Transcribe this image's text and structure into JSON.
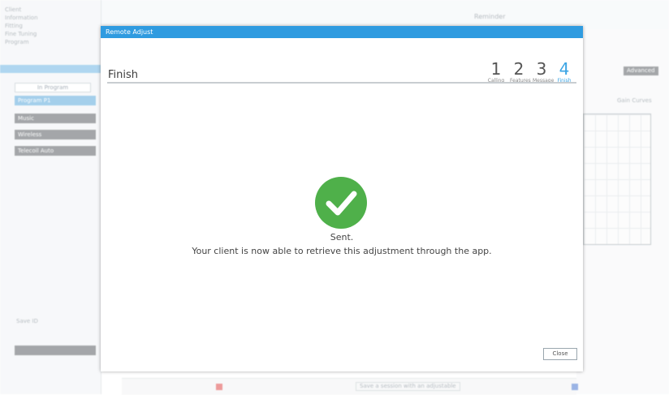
{
  "background": {
    "left_items": [
      "Client",
      "Information",
      "Fitting",
      "Fine Tuning",
      "Program"
    ],
    "in_program_label": "In Program",
    "program_buttons": [
      "Program P1",
      "Music",
      "Wireless",
      "Telecoil Auto"
    ],
    "record_label": "Save ID",
    "right_tab_label": "Advanced",
    "right_graph_label": "Gain Curves",
    "top_center_label": "Reminder",
    "bottom_status": "Save a session with an adjustable"
  },
  "dialog": {
    "titlebar": "Remote Adjust",
    "title": "Finish",
    "steps": [
      {
        "num": "1",
        "label": "Calling"
      },
      {
        "num": "2",
        "label": "Features"
      },
      {
        "num": "3",
        "label": "Message"
      },
      {
        "num": "4",
        "label": "Finish"
      }
    ],
    "message_line1": "Sent.",
    "message_line2": "Your client is now able to retrieve this adjustment through the app.",
    "close_label": "Close"
  },
  "colors": {
    "accent": "#2f9be0",
    "success": "#4fb04a",
    "step_active": "#3aa4e4"
  },
  "icons": {
    "status": "check-icon"
  }
}
